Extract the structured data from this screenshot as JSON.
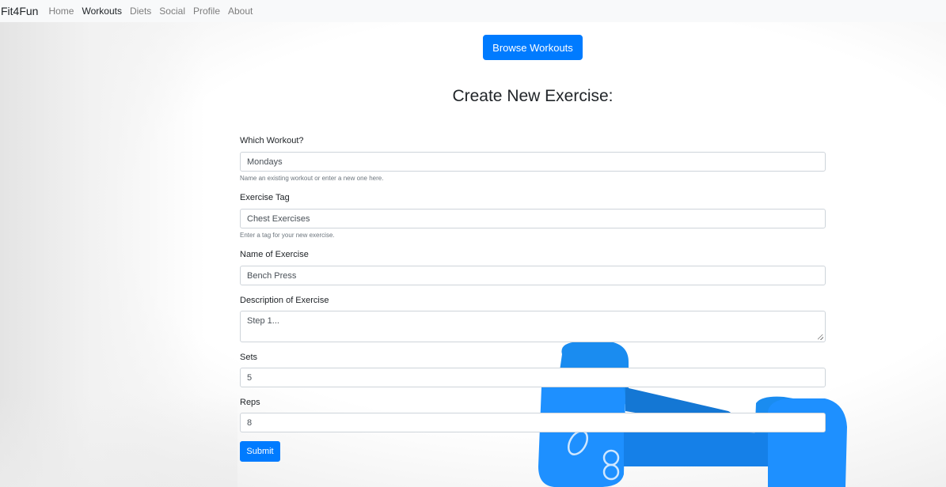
{
  "navbar": {
    "brand": "Fit4Fun",
    "links": [
      {
        "label": "Home",
        "active": false
      },
      {
        "label": "Workouts",
        "active": true
      },
      {
        "label": "Diets",
        "active": false
      },
      {
        "label": "Social",
        "active": false
      },
      {
        "label": "Profile",
        "active": false
      },
      {
        "label": "About",
        "active": false
      }
    ]
  },
  "browse_button": "Browse Workouts",
  "title": "Create New Exercise:",
  "form": {
    "workout": {
      "label": "Which Workout?",
      "placeholder": "Mondays",
      "help": "Name an existing workout or enter a new one here."
    },
    "tag": {
      "label": "Exercise Tag",
      "placeholder": "Chest Exercises",
      "help": "Enter a tag for your new exercise."
    },
    "name": {
      "label": "Name of Exercise",
      "placeholder": "Bench Press"
    },
    "description": {
      "label": "Description of Exercise",
      "placeholder": "Step 1..."
    },
    "sets": {
      "label": "Sets",
      "placeholder": "5"
    },
    "reps": {
      "label": "Reps",
      "placeholder": "8"
    },
    "submit_label": "Submit"
  },
  "colors": {
    "primary": "#007bff",
    "navbar_bg": "#f8f9fa",
    "dumbbell": "#1e90ff"
  },
  "background_image": "blue-dumbbells"
}
